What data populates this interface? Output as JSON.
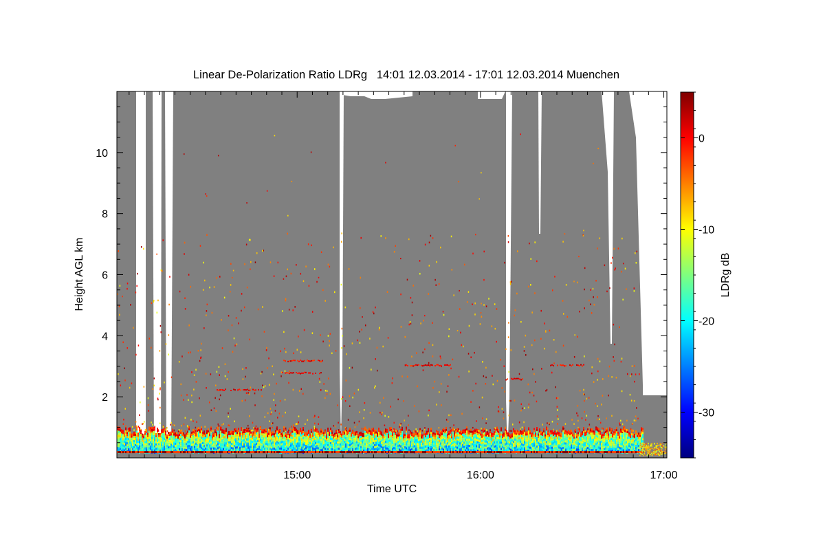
{
  "chart_data": {
    "type": "heatmap",
    "title": "Linear De-Polarization Ratio LDRg   14:01 12.03.2014 - 17:01 12.03.2014 Muenchen",
    "xlabel": "Time UTC",
    "ylabel": "Height AGL km",
    "colorbar_label": "LDRg dB",
    "xlim": [
      "14:01",
      "17:01"
    ],
    "ylim": [
      0,
      12
    ],
    "x_tick_labels": [
      "15:00",
      "16:00",
      "17:00"
    ],
    "y_tick_labels": [
      "2",
      "4",
      "6",
      "8",
      "10"
    ],
    "y_ticks": [
      2,
      4,
      6,
      8,
      10
    ],
    "colorbar_range": [
      -35,
      5
    ],
    "colorbar_ticks": [
      0,
      -10,
      -20,
      -30
    ],
    "colorbar_tick_labels": [
      "0",
      "-10",
      "-20",
      "-30"
    ],
    "no_signal_color": "#808080",
    "colormap": "jet",
    "grid": false,
    "layers": [
      {
        "name": "near-surface aerosol layer",
        "height_km": [
          0.2,
          0.9
        ],
        "ldr_db": [
          -25,
          -5
        ]
      },
      {
        "name": "lofted aerosol patches",
        "height_km": [
          2.0,
          3.1
        ],
        "ldr_db": [
          -5,
          0
        ]
      },
      {
        "name": "gaps without data",
        "times": [
          "14:08",
          "14:14",
          "14:19",
          "15:15",
          "16:10",
          "16:22",
          "16:44",
          "16:52"
        ]
      }
    ]
  },
  "colors": {
    "background": "#ffffff",
    "no_signal": "#808080",
    "colormap": [
      "#00007f",
      "#0000ff",
      "#007fff",
      "#00ffff",
      "#7fff7f",
      "#ffff00",
      "#ff7f00",
      "#ff0000",
      "#7f0000"
    ]
  }
}
